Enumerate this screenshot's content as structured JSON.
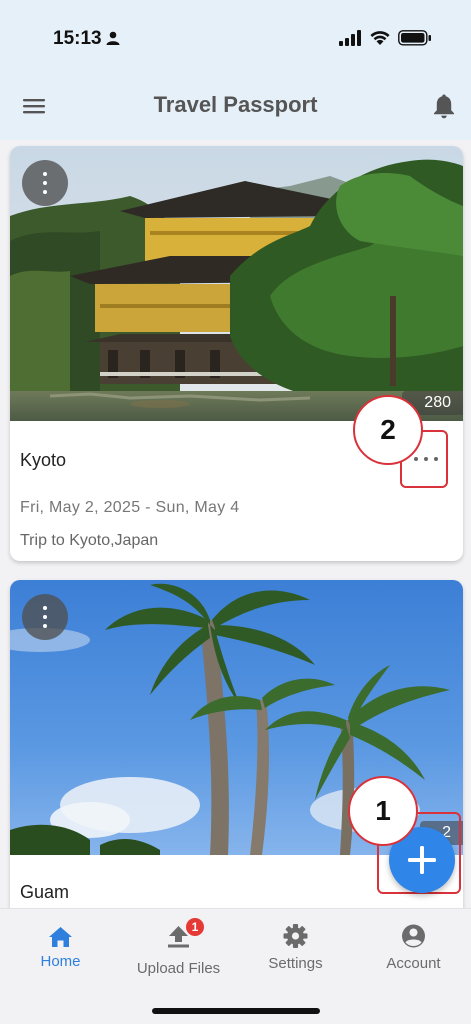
{
  "status_bar": {
    "time": "15:13"
  },
  "app_bar": {
    "title": "Travel Passport"
  },
  "trips": [
    {
      "title": "Kyoto",
      "dates": "Fri, May 2, 2025 - Sun, May 4",
      "description": "Trip to Kyoto,Japan",
      "photo_count": "280",
      "photo_subject": "Kinkaku-ji golden pavilion with pine trees"
    },
    {
      "title": "Guam",
      "photo_count": "2",
      "photo_subject": "palm trees under blue sky"
    }
  ],
  "annotations": {
    "marker_1": "1",
    "marker_2": "2"
  },
  "bottom_nav": {
    "items": [
      {
        "label": "Home",
        "icon": "home-icon",
        "active": true
      },
      {
        "label": "Upload Files",
        "icon": "upload-icon",
        "badge": "1"
      },
      {
        "label": "Settings",
        "icon": "gear-icon"
      },
      {
        "label": "Account",
        "icon": "account-icon"
      }
    ]
  },
  "colors": {
    "accent": "#2f86e8",
    "app_bar_bg": "#e6f0f9",
    "annotation_red": "#d9323a",
    "badge_red": "#e53935"
  }
}
